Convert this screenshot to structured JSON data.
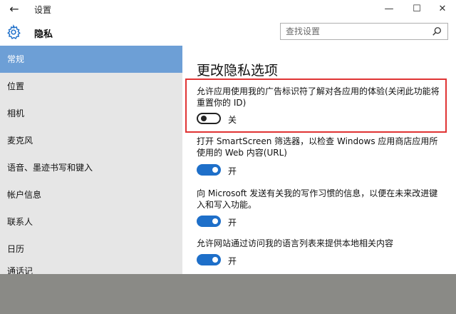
{
  "window": {
    "title": "设置",
    "back_glyph": "←",
    "min_glyph": "—",
    "max_glyph": "☐",
    "close_glyph": "✕"
  },
  "header": {
    "title": "隐私",
    "search_placeholder": "查找设置"
  },
  "sidebar": {
    "items": [
      {
        "label": "常规",
        "selected": true
      },
      {
        "label": "位置"
      },
      {
        "label": "相机"
      },
      {
        "label": "麦克风"
      },
      {
        "label": "语音、墨迹书写和键入"
      },
      {
        "label": "帐户信息"
      },
      {
        "label": "联系人"
      },
      {
        "label": "日历"
      },
      {
        "label": "通话记"
      }
    ]
  },
  "main": {
    "title": "更改隐私选项",
    "settings": [
      {
        "text": "允许应用使用我的广告标识符了解对各应用的体验(关闭此功能将重置你的 ID)",
        "state": "关",
        "on": false
      },
      {
        "text": "打开 SmartScreen 筛选器，以检查 Windows 应用商店应用所使用的 Web 内容(URL)",
        "state": "开",
        "on": true
      },
      {
        "text": "向 Microsoft 发送有关我的写作习惯的信息，以便在未来改进键入和写入功能。",
        "state": "开",
        "on": true
      },
      {
        "text": "允许网站通过访问我的语言列表来提供本地相关内容",
        "state": "开",
        "on": true
      }
    ]
  },
  "colors": {
    "accent": "#1e6fc9",
    "sidebar_selected": "#6d9fd6",
    "highlight": "#e03434"
  },
  "icons": [
    "back-arrow-icon",
    "gear-icon",
    "search-icon",
    "minimize-icon",
    "maximize-icon",
    "close-icon"
  ]
}
